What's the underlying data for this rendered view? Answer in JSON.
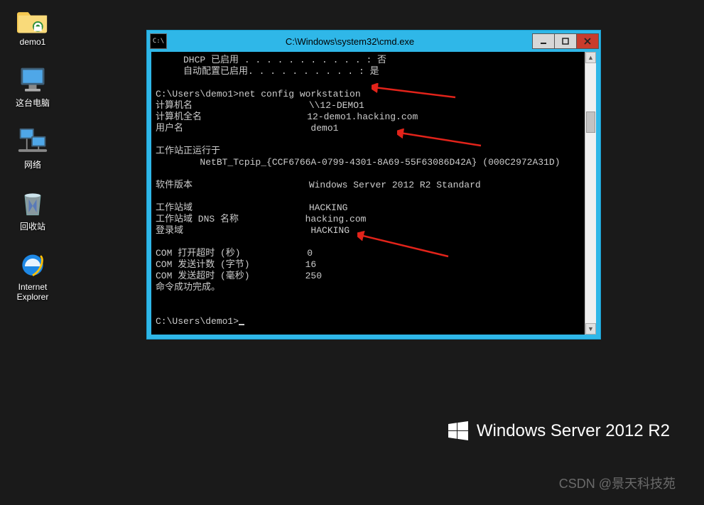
{
  "desktop": {
    "icons": [
      {
        "name": "folder-demo1",
        "label": "demo1"
      },
      {
        "name": "this-pc",
        "label": "这台电脑"
      },
      {
        "name": "network",
        "label": "网络"
      },
      {
        "name": "recycle-bin",
        "label": "回收站"
      },
      {
        "name": "internet-explorer",
        "label": "Internet\nExplorer"
      }
    ]
  },
  "window": {
    "title": "C:\\Windows\\system32\\cmd.exe",
    "app_icon": "C:\\"
  },
  "cmd": {
    "l1a": "     DHCP 已启用 . . . . . . . . . . . : 否",
    "l1b": "     自动配置已启用. . . . . . . . . . : 是",
    "l2": "",
    "l3": "C:\\Users\\demo1>net config workstation",
    "l4": "计算机名                     \\\\12-DEMO1",
    "l5": "计算机全名                   12-demo1.hacking.com",
    "l6": "用户名                       demo1",
    "l7": "",
    "l8": "工作站正运行于",
    "l9": "        NetBT_Tcpip_{CCF6766A-0799-4301-8A69-55F63086D42A} (000C2972A31D)",
    "l10": "",
    "l11": "软件版本                     Windows Server 2012 R2 Standard",
    "l12": "",
    "l13": "工作站域                     HACKING",
    "l14": "工作站域 DNS 名称            hacking.com",
    "l15": "登录域                       HACKING",
    "l16": "",
    "l17": "COM 打开超时 (秒)            0",
    "l18": "COM 发送计数 (字节)          16",
    "l19": "COM 发送超时 (毫秒)          250",
    "l20": "命令成功完成。",
    "l21": "",
    "l22": "",
    "prompt": "C:\\Users\\demo1>"
  },
  "branding": {
    "text": "Windows Server 2012 R2"
  },
  "watermark": "CSDN @景天科技苑"
}
